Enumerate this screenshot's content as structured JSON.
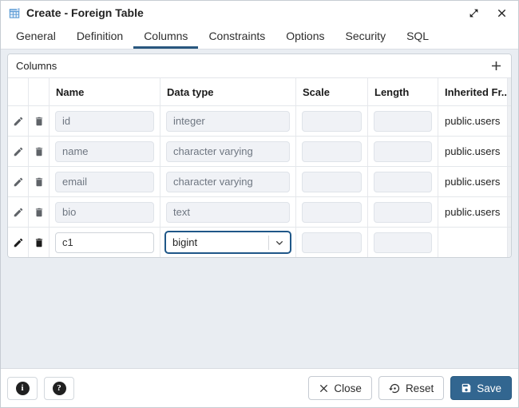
{
  "dialog": {
    "title": "Create - Foreign Table"
  },
  "tabs": [
    "General",
    "Definition",
    "Columns",
    "Constraints",
    "Options",
    "Security",
    "SQL"
  ],
  "active_tab": "Columns",
  "panel": {
    "title": "Columns"
  },
  "grid": {
    "headers": [
      "Name",
      "Data type",
      "Scale",
      "Length",
      "Inherited Fr..."
    ],
    "rows": [
      {
        "name": "id",
        "data_type": "integer",
        "scale": "",
        "length": "",
        "inherited_from": "public.users",
        "editable": false
      },
      {
        "name": "name",
        "data_type": "character varying",
        "scale": "",
        "length": "",
        "inherited_from": "public.users",
        "editable": false
      },
      {
        "name": "email",
        "data_type": "character varying",
        "scale": "",
        "length": "",
        "inherited_from": "public.users",
        "editable": false
      },
      {
        "name": "bio",
        "data_type": "text",
        "scale": "",
        "length": "",
        "inherited_from": "public.users",
        "editable": false
      },
      {
        "name": "c1",
        "data_type": "bigint",
        "scale": "",
        "length": "",
        "inherited_from": "",
        "editable": true
      }
    ]
  },
  "footer": {
    "close_label": "Close",
    "reset_label": "Reset",
    "save_label": "Save"
  },
  "icons": {
    "title": "foreign-table-grid-icon",
    "info_glyph": "i",
    "help_glyph": "?",
    "add": "plus-icon",
    "window": [
      "expand-icon",
      "close-icon"
    ]
  },
  "colors": {
    "accent": "#326690",
    "active_tab_underline": "#29577f",
    "content_background": "#e9edf2",
    "disabled_input_background": "#f0f2f6",
    "save_button_background": "#326690"
  }
}
